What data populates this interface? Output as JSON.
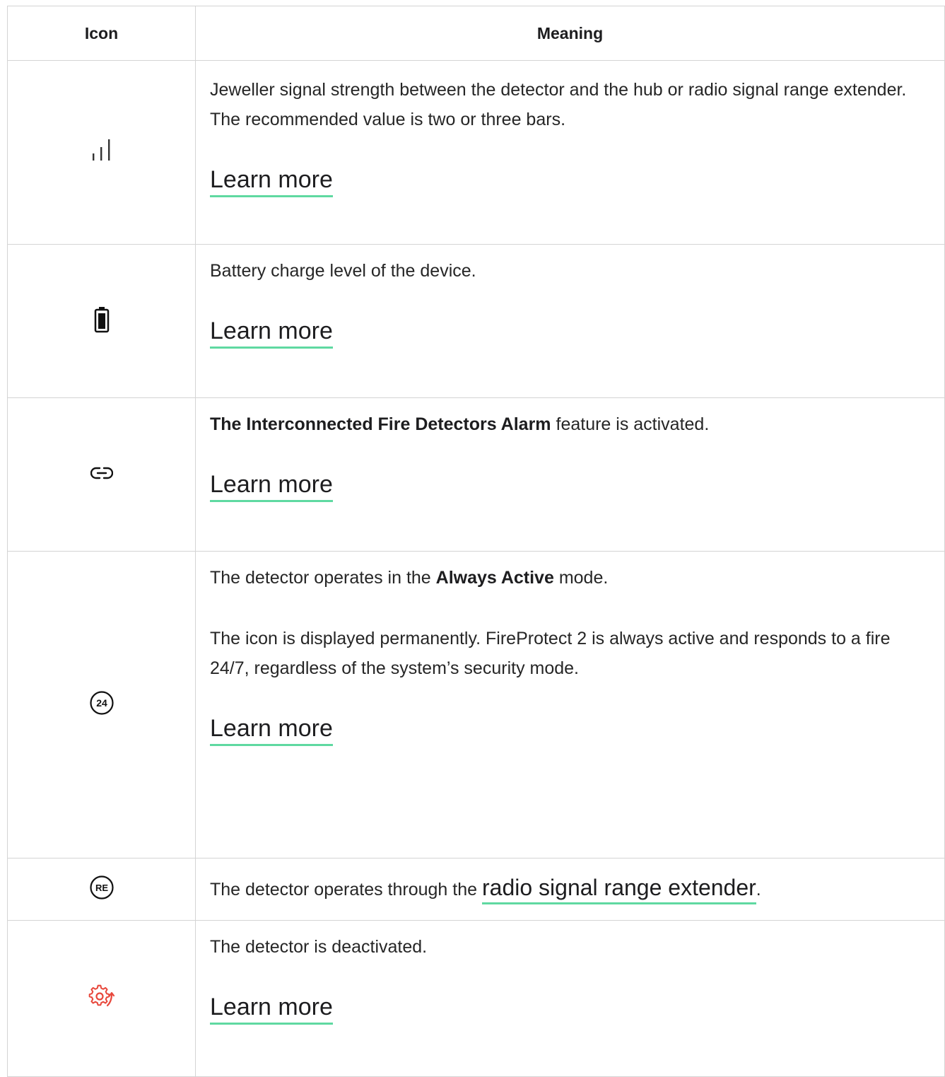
{
  "table": {
    "headers": {
      "icon": "Icon",
      "meaning": "Meaning"
    },
    "rows": [
      {
        "icon": "signal-bars-icon",
        "paragraphs": [
          "Jeweller signal strength between the detector and the hub or radio signal range extender. The recommended value is two or three bars."
        ],
        "link": "Learn more"
      },
      {
        "icon": "battery-icon",
        "paragraphs": [
          "Battery charge level of the device."
        ],
        "link": "Learn more"
      },
      {
        "icon": "link-icon",
        "bold": "The Interconnected Fire Detectors Alarm",
        "text_after": " feature is activated.",
        "link": "Learn more"
      },
      {
        "icon": "always-active-24-icon",
        "badge_text": "24",
        "text_before": "The detector operates in the ",
        "bold": "Always Active",
        "text_after": " mode.",
        "paragraph2": "The icon is displayed permanently. FireProtect 2 is always active and responds to a fire 24/7, regardless of the system’s security mode.",
        "link": "Learn more"
      },
      {
        "icon": "range-extender-icon",
        "badge_text": "RE",
        "text_before": "The detector operates through the ",
        "link": "radio signal range extender",
        "text_after": "."
      },
      {
        "icon": "deactivated-gear-icon",
        "paragraphs": [
          "The detector is deactivated."
        ],
        "link": "Learn more"
      }
    ]
  },
  "colors": {
    "link_underline": "#5fd9a1",
    "border": "#d4d4d4",
    "deactivated_icon": "#e8483c",
    "text": "#1d1d1f"
  }
}
